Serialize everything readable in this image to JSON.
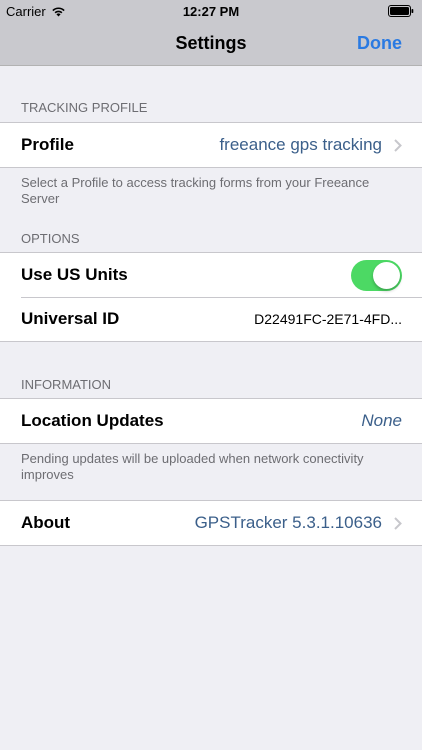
{
  "status_bar": {
    "carrier": "Carrier",
    "time": "12:27 PM"
  },
  "nav": {
    "title": "Settings",
    "done_label": "Done"
  },
  "tracking_profile": {
    "header": "TRACKING PROFILE",
    "profile_label": "Profile",
    "profile_value": "freeance gps tracking",
    "footer": "Select a Profile to access tracking forms from your Freeance Server"
  },
  "options": {
    "header": "OPTIONS",
    "us_units_label": "Use US Units",
    "us_units_on": true,
    "universal_id_label": "Universal ID",
    "universal_id_value": "D22491FC-2E71-4FD..."
  },
  "information": {
    "header": "INFORMATION",
    "location_updates_label": "Location Updates",
    "location_updates_value": "None",
    "footer": "Pending updates will be uploaded when network conectivity improves"
  },
  "about": {
    "label": "About",
    "value": "GPSTracker 5.3.1.10636"
  },
  "colors": {
    "accent": "#2a7ae2",
    "toggle_on": "#4cd964",
    "value_text": "#3b5f8a"
  }
}
